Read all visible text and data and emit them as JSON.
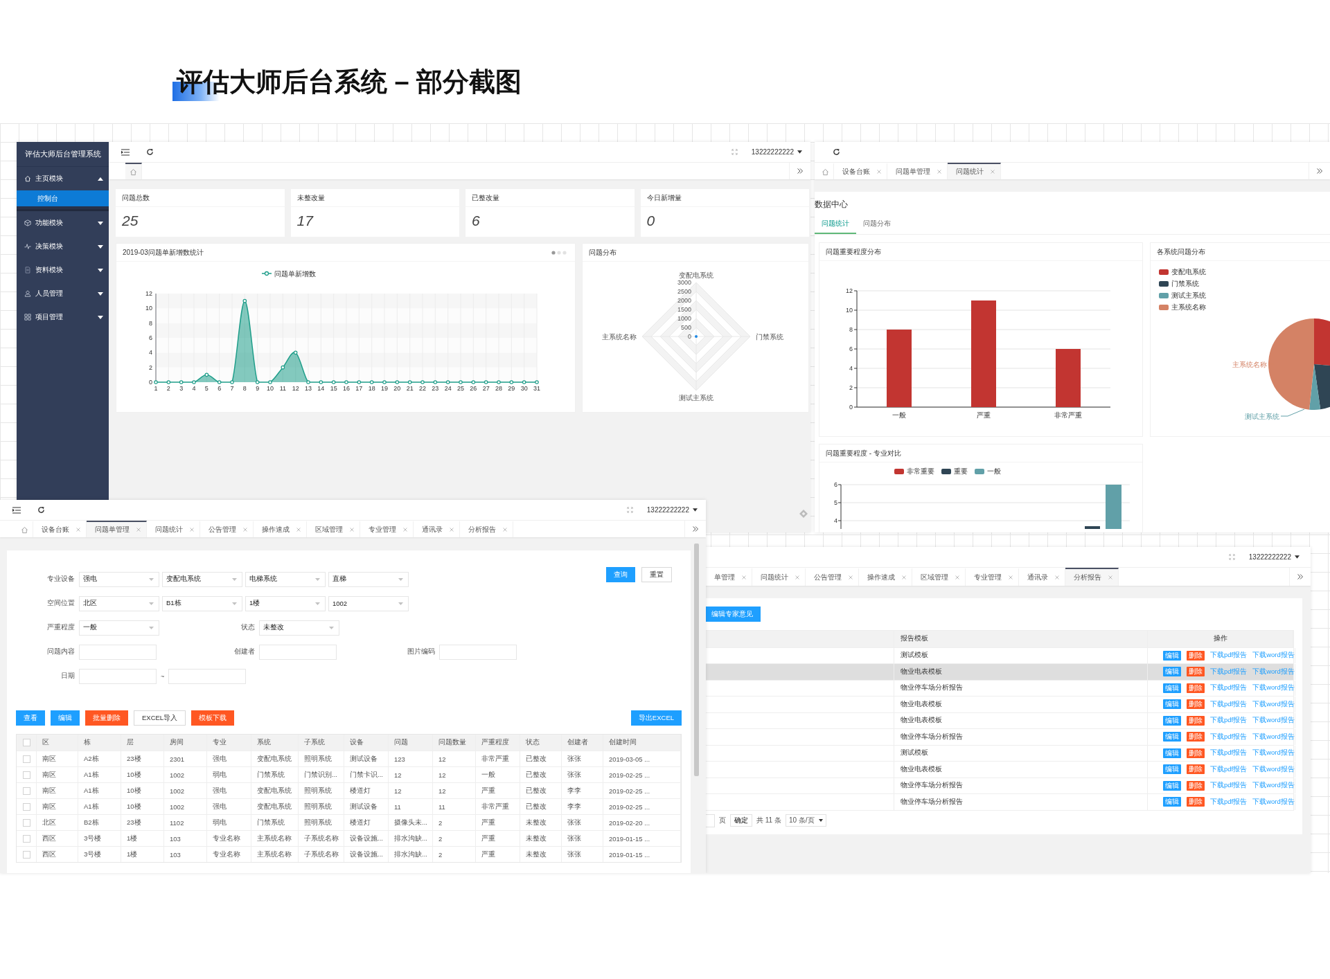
{
  "page_title": "评估大师后台系统 – 部分截图",
  "dashboard": {
    "sidebar": {
      "title": "评估大师后台管理系统",
      "items": [
        {
          "label": "主页模块",
          "expanded": true,
          "children": [
            {
              "label": "控制台",
              "selected": true
            }
          ]
        },
        {
          "label": "功能模块",
          "expanded": false
        },
        {
          "label": "决策模块",
          "expanded": false
        },
        {
          "label": "资料模块",
          "expanded": false
        },
        {
          "label": "人员管理",
          "expanded": false
        },
        {
          "label": "项目管理",
          "expanded": false
        }
      ]
    },
    "user": "13222222222",
    "tabs": [
      {
        "kind": "home",
        "selected": true
      }
    ],
    "stats": [
      {
        "label": "问题总数",
        "value": "25"
      },
      {
        "label": "未整改量",
        "value": "17"
      },
      {
        "label": "已整改量",
        "value": "6"
      },
      {
        "label": "今日新增量",
        "value": "0"
      }
    ],
    "trend": {
      "title": "2019-03问题单新增数统计",
      "chart_data": {
        "type": "line",
        "x": [
          1,
          2,
          3,
          4,
          5,
          6,
          7,
          8,
          9,
          10,
          11,
          12,
          13,
          14,
          15,
          16,
          17,
          18,
          19,
          20,
          21,
          22,
          23,
          24,
          25,
          26,
          27,
          28,
          29,
          30,
          31
        ],
        "series": [
          {
            "name": "问题单新增数",
            "color": "#1f9e8a",
            "marker": true,
            "values": [
              0,
              0,
              0,
              0,
              1,
              0,
              0,
              11,
              0,
              0,
              2,
              4,
              0,
              0,
              0,
              0,
              0,
              0,
              0,
              0,
              0,
              0,
              0,
              0,
              0,
              0,
              0,
              0,
              0,
              0,
              0
            ]
          }
        ],
        "ylim": [
          0,
          12
        ],
        "yticks": [
          0,
          2,
          4,
          6,
          8,
          10,
          12
        ],
        "grid": true
      }
    },
    "distribution": {
      "title": "问题分布",
      "axes": [
        "变配电系统",
        "门禁系统",
        "测试主系统",
        "主系统名称"
      ],
      "ticks": [
        "3000",
        "2500",
        "2000",
        "1500",
        "1000",
        "500",
        "0"
      ]
    }
  },
  "statistics_window": {
    "tabs": [
      {
        "kind": "home",
        "selected": false
      },
      {
        "kind": "page",
        "label": "设备台账",
        "selected": false
      },
      {
        "kind": "page",
        "label": "问题单管理",
        "selected": false
      },
      {
        "kind": "page",
        "label": "问题统计",
        "selected": true
      }
    ],
    "heading": "数据中心",
    "subtabs": [
      {
        "label": "问题统计",
        "selected": true
      },
      {
        "label": "问题分布",
        "selected": false
      }
    ],
    "severity": {
      "title": "问题重要程度分布",
      "chart_data": {
        "type": "bar",
        "categories": [
          "一般",
          "严重",
          "非常严重"
        ],
        "values": [
          8,
          11,
          6
        ],
        "ylim": [
          0,
          12
        ],
        "yticks": [
          0,
          2,
          4,
          6,
          8,
          10,
          12
        ],
        "grid": true
      }
    },
    "systems": {
      "title": "各系统问题分布",
      "legend": [
        {
          "label": "变配电系统",
          "color": "#c23531"
        },
        {
          "label": "门禁系统",
          "color": "#2f4554"
        },
        {
          "label": "测试主系统",
          "color": "#61a0a8"
        },
        {
          "label": "主系统名称",
          "color": "#d48265"
        }
      ],
      "callouts": [
        "主系统名称",
        "测试主系统"
      ]
    },
    "comparison": {
      "title": "问题重要程度 - 专业对比",
      "legend": [
        {
          "label": "非常重要",
          "color": "#c23531"
        },
        {
          "label": "重要",
          "color": "#2f4554"
        },
        {
          "label": "一般",
          "color": "#61a0a8"
        }
      ],
      "ticks": [
        "6",
        "5",
        "4"
      ]
    }
  },
  "issue_window": {
    "user": "13222222222",
    "tabs": [
      {
        "kind": "home",
        "selected": false
      },
      {
        "kind": "page",
        "label": "设备台账",
        "selected": false
      },
      {
        "kind": "page",
        "label": "问题单管理",
        "selected": true
      },
      {
        "kind": "page",
        "label": "问题统计",
        "selected": false
      },
      {
        "kind": "page",
        "label": "公告管理",
        "selected": false
      },
      {
        "kind": "page",
        "label": "操作速成",
        "selected": false
      },
      {
        "kind": "page",
        "label": "区域管理",
        "selected": false
      },
      {
        "kind": "page",
        "label": "专业管理",
        "selected": false
      },
      {
        "kind": "page",
        "label": "通讯录",
        "selected": false
      },
      {
        "kind": "page",
        "label": "分析报告",
        "selected": false
      }
    ],
    "filters": [
      [
        {
          "label": "专业设备",
          "fields": [
            {
              "kind": "select",
              "value": "强电"
            },
            {
              "kind": "select",
              "value": "变配电系统"
            },
            {
              "kind": "select",
              "value": "电梯系统"
            },
            {
              "kind": "select",
              "value": "直梯"
            }
          ]
        }
      ],
      [
        {
          "label": "空间位置",
          "fields": [
            {
              "kind": "select",
              "value": "北区"
            },
            {
              "kind": "select",
              "value": "B1栋"
            },
            {
              "kind": "select",
              "value": "1楼"
            },
            {
              "kind": "select",
              "value": "1002"
            }
          ]
        }
      ],
      [
        {
          "label": "严重程度",
          "fields": [
            {
              "kind": "select",
              "value": "一般"
            }
          ]
        },
        {
          "label": "状态",
          "fields": [
            {
              "kind": "select",
              "value": "未整改"
            }
          ]
        }
      ],
      [
        {
          "label": "问题内容",
          "fields": [
            {
              "kind": "input"
            }
          ]
        },
        {
          "label": "创建者",
          "fields": [
            {
              "kind": "input"
            }
          ]
        },
        {
          "label": "图片编码",
          "fields": [
            {
              "kind": "input"
            }
          ]
        }
      ],
      [
        {
          "label": "日期",
          "fields": [
            {
              "kind": "input"
            },
            {
              "kind": "separator",
              "text": "~"
            },
            {
              "kind": "input"
            }
          ]
        }
      ]
    ],
    "form_buttons": [
      {
        "label": "查询",
        "kind": "primary"
      },
      {
        "label": "重置",
        "kind": "plain"
      }
    ],
    "actions": [
      {
        "label": "查看",
        "kind": "primary"
      },
      {
        "label": "编辑",
        "kind": "primary"
      },
      {
        "label": "批量删除",
        "kind": "danger"
      },
      {
        "label": "EXCEL导入",
        "kind": "plain"
      },
      {
        "label": "模板下载",
        "kind": "danger"
      }
    ],
    "export_button": {
      "label": "导出EXCEL",
      "kind": "primary"
    },
    "columns": [
      "区",
      "栋",
      "层",
      "房间",
      "专业",
      "系统",
      "子系统",
      "设备",
      "问题",
      "问题数量",
      "严重程度",
      "状态",
      "创建者",
      "创建时间"
    ],
    "header_checked": false,
    "rows": [
      {
        "checked": false,
        "cells": [
          "南区",
          "A2栋",
          "23楼",
          "2301",
          "强电",
          "变配电系统",
          "照明系统",
          "测试设备",
          "123",
          "12",
          "非常严重",
          "已整改",
          "张张",
          "2019-03-05 ..."
        ]
      },
      {
        "checked": false,
        "cells": [
          "南区",
          "A1栋",
          "10楼",
          "1002",
          "弱电",
          "门禁系统",
          "门禁识别...",
          "门禁卡识...",
          "12",
          "12",
          "一般",
          "已整改",
          "张张",
          "2019-02-25 ..."
        ]
      },
      {
        "checked": false,
        "cells": [
          "南区",
          "A1栋",
          "10楼",
          "1002",
          "强电",
          "变配电系统",
          "照明系统",
          "楼道灯",
          "12",
          "12",
          "严重",
          "已整改",
          "李李",
          "2019-02-25 ..."
        ]
      },
      {
        "checked": false,
        "cells": [
          "南区",
          "A1栋",
          "10楼",
          "1002",
          "强电",
          "变配电系统",
          "照明系统",
          "测试设备",
          "11",
          "11",
          "非常严重",
          "已整改",
          "李李",
          "2019-02-25 ..."
        ]
      },
      {
        "checked": false,
        "cells": [
          "北区",
          "B2栋",
          "23楼",
          "1102",
          "弱电",
          "门禁系统",
          "照明系统",
          "楼道灯",
          "摄像头未...",
          "2",
          "严重",
          "未整改",
          "张张",
          "2019-02-20 ..."
        ]
      },
      {
        "checked": false,
        "cells": [
          "西区",
          "3号楼",
          "1楼",
          "103",
          "专业名称",
          "主系统名称",
          "子系统名称",
          "设备设施...",
          "排水沟缺...",
          "2",
          "严重",
          "未整改",
          "张张",
          "2019-01-15 ..."
        ]
      },
      {
        "checked": false,
        "cells": [
          "西区",
          "3号楼",
          "1楼",
          "103",
          "专业名称",
          "主系统名称",
          "子系统名称",
          "设备设施...",
          "排水沟缺...",
          "2",
          "严重",
          "未整改",
          "张张",
          "2019-01-15 ..."
        ]
      }
    ]
  },
  "report_window": {
    "user": "13222222222",
    "tabs": [
      {
        "kind": "page",
        "label": "单管理",
        "selected": false
      },
      {
        "kind": "page",
        "label": "问题统计",
        "selected": false
      },
      {
        "kind": "page",
        "label": "公告管理",
        "selected": false
      },
      {
        "kind": "page",
        "label": "操作速成",
        "selected": false
      },
      {
        "kind": "page",
        "label": "区域管理",
        "selected": false
      },
      {
        "kind": "page",
        "label": "专业管理",
        "selected": false
      },
      {
        "kind": "page",
        "label": "通讯录",
        "selected": false
      },
      {
        "kind": "page",
        "label": "分析报告",
        "selected": true
      }
    ],
    "edit_button": "编辑专家意见",
    "columns": [
      "报告模板",
      "操作"
    ],
    "rows": [
      {
        "template": "测试模板",
        "selected": false,
        "actions": [
          "编辑",
          "删除",
          "下载pdf报告",
          "下载word报告"
        ]
      },
      {
        "template": "物业电表模板",
        "selected": true,
        "actions": [
          "编辑",
          "删除",
          "下载pdf报告",
          "下载word报告"
        ]
      },
      {
        "template": "物业停车场分析报告",
        "selected": false,
        "actions": [
          "编辑",
          "删除",
          "下载pdf报告",
          "下载word报告"
        ]
      },
      {
        "template": "物业电表模板",
        "selected": false,
        "actions": [
          "编辑",
          "删除",
          "下载pdf报告",
          "下载word报告"
        ]
      },
      {
        "template": "物业电表模板",
        "selected": false,
        "actions": [
          "编辑",
          "删除",
          "下载pdf报告",
          "下载word报告"
        ]
      },
      {
        "template": "物业停车场分析报告",
        "selected": false,
        "actions": [
          "编辑",
          "删除",
          "下载pdf报告",
          "下载word报告"
        ]
      },
      {
        "template": "测试模板",
        "selected": false,
        "actions": [
          "编辑",
          "删除",
          "下载pdf报告",
          "下载word报告"
        ]
      },
      {
        "template": "物业电表模板",
        "selected": false,
        "actions": [
          "编辑",
          "删除",
          "下载pdf报告",
          "下载word报告"
        ]
      },
      {
        "template": "物业停车场分析报告",
        "selected": false,
        "actions": [
          "编辑",
          "删除",
          "下载pdf报告",
          "下载word报告"
        ]
      },
      {
        "template": "物业停车场分析报告",
        "selected": false,
        "actions": [
          "编辑",
          "删除",
          "下载pdf报告",
          "下载word报告"
        ]
      }
    ],
    "pagination": {
      "page_label": "页",
      "confirm": "确定",
      "total": "共 11 条",
      "page_size": "10 条/页"
    }
  }
}
